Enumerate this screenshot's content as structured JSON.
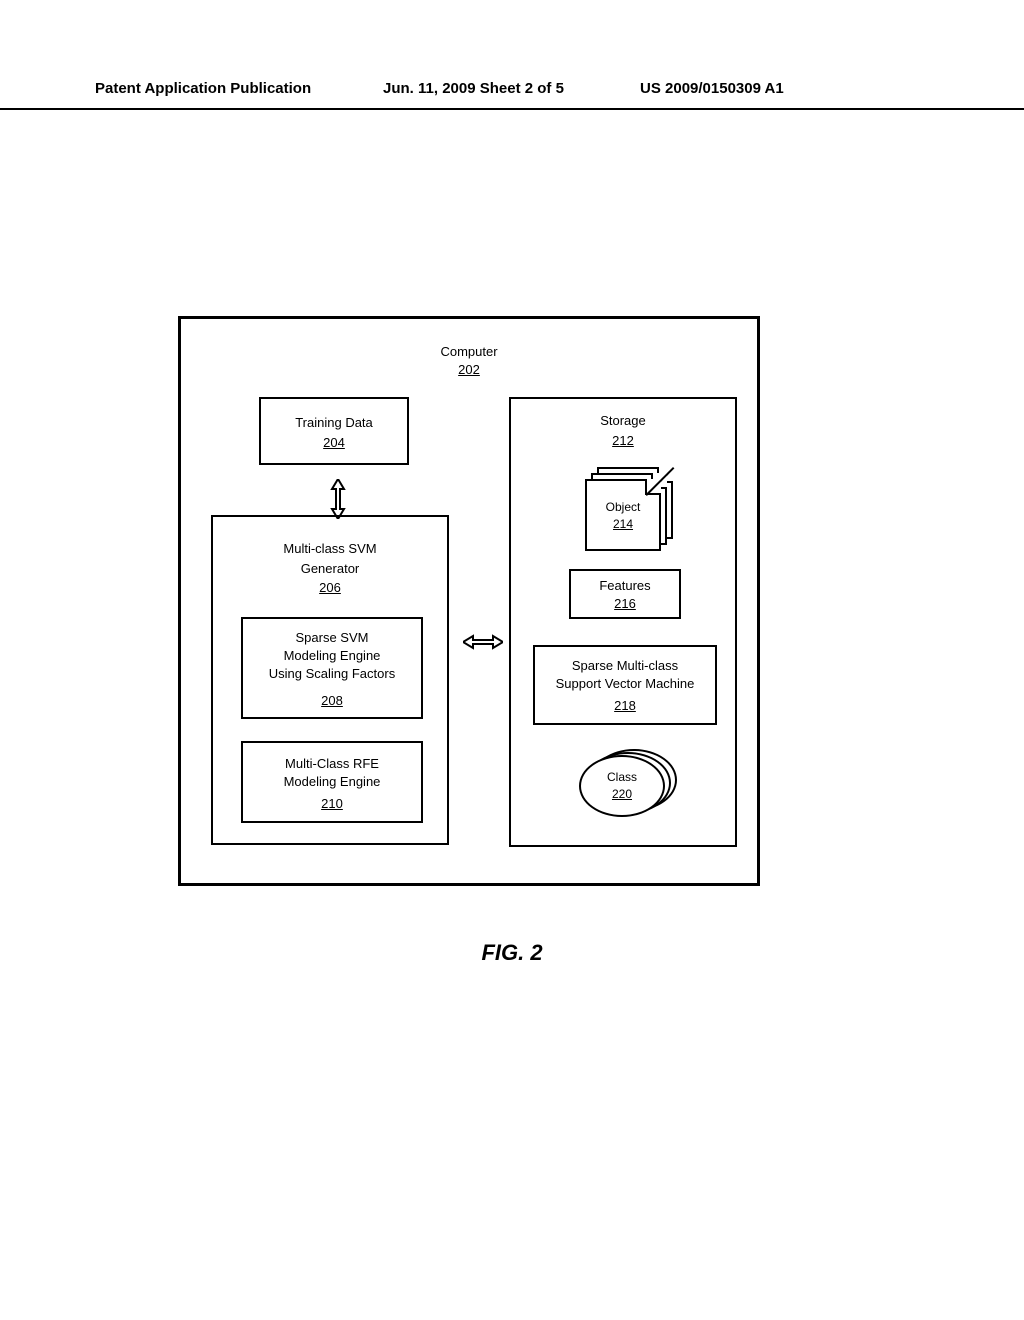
{
  "header": {
    "left": "Patent Application Publication",
    "mid": "Jun. 11, 2009  Sheet 2 of 5",
    "right": "US 2009/0150309 A1"
  },
  "computer": {
    "label": "Computer",
    "ref": "202"
  },
  "training": {
    "label": "Training Data",
    "ref": "204"
  },
  "generator": {
    "label": "Multi-class SVM\nGenerator",
    "ref": "206"
  },
  "sparse_engine": {
    "label": "Sparse SVM\nModeling Engine\nUsing Scaling Factors",
    "ref": "208"
  },
  "rfe_engine": {
    "label": "Multi-Class RFE\nModeling Engine",
    "ref": "210"
  },
  "storage": {
    "label": "Storage",
    "ref": "212"
  },
  "object": {
    "label": "Object",
    "ref": "214"
  },
  "features": {
    "label": "Features",
    "ref": "216"
  },
  "svm": {
    "label": "Sparse Multi-class\nSupport Vector Machine",
    "ref": "218"
  },
  "class": {
    "label": "Class",
    "ref": "220"
  },
  "caption": "FIG. 2"
}
